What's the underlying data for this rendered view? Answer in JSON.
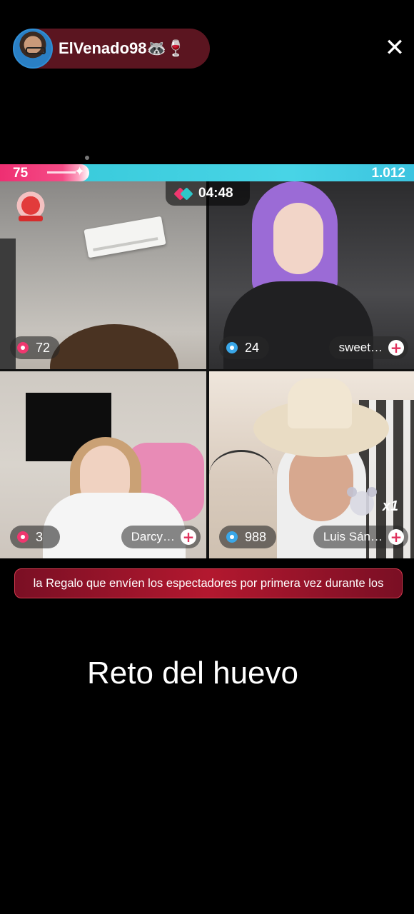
{
  "header": {
    "host_name": "ElVenado98🦝🍷",
    "close_glyph": "✕"
  },
  "score_bar": {
    "left_score": "75",
    "right_score": "1.012",
    "left_color": "#ee2f72",
    "right_color": "#35c8d8"
  },
  "battle": {
    "timer": "04:48"
  },
  "panels": [
    {
      "stat_icon": "pink-alarm-icon",
      "stat_value": "72"
    },
    {
      "stat_icon": "blue-alarm-icon",
      "stat_value": "24",
      "name": "sweet…"
    },
    {
      "stat_icon": "pink-alarm-icon",
      "stat_value": "3",
      "name": "Darcy…"
    },
    {
      "stat_icon": "blue-alarm-icon",
      "stat_value": "988",
      "name": "Luis Sán…",
      "multiplier": "x1"
    }
  ],
  "plus_glyph": "+",
  "banner": {
    "text": "la Regalo que envíen los espectadores por primera vez durante los"
  },
  "caption": "Reto del huevo"
}
